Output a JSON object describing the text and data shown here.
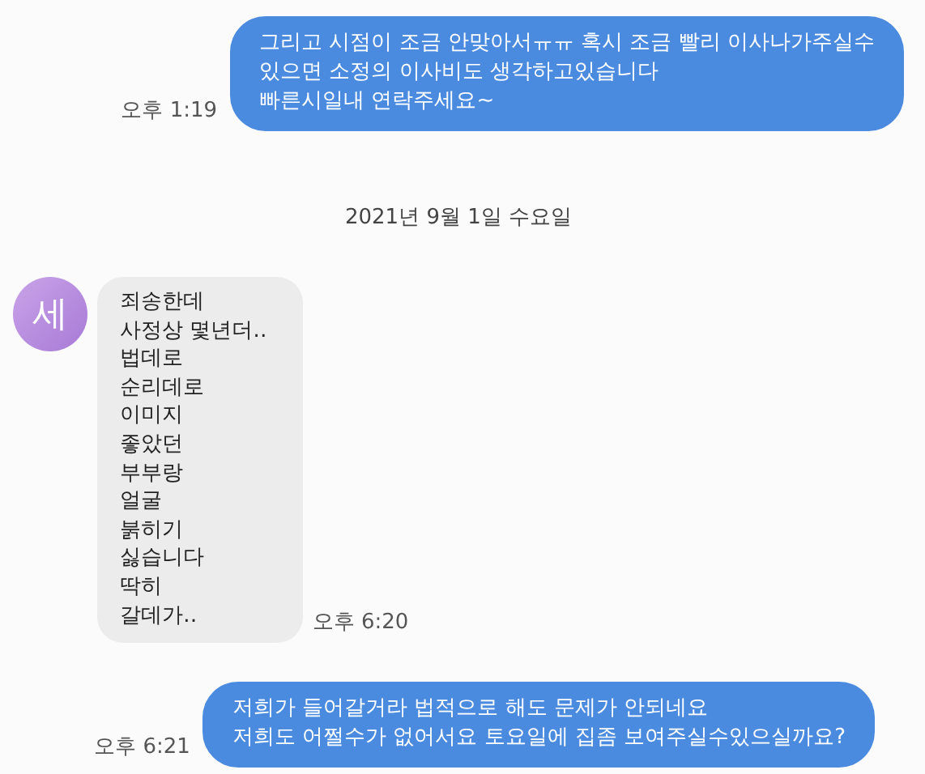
{
  "messages": [
    {
      "kind": "sent",
      "lines": [
        "그리고 시점이 조금 안맞아서ㅠㅠ 혹시 조금 빨리 이사나가주실수",
        "있으면 소정의 이사비도 생각하고있습니다",
        "빠른시일내 연락주세요~"
      ],
      "time": "오후 1:19"
    },
    {
      "kind": "date",
      "text": "2021년 9월 1일 수요일"
    },
    {
      "kind": "received",
      "avatar": "세",
      "lines": [
        "죄송한데",
        "사정상 몇년더‥",
        "법데로",
        "순리데로",
        "이미지",
        "좋았던",
        "부부랑",
        "얼굴",
        "붉히기",
        "싫습니다",
        "딱히",
        "갈데가‥"
      ],
      "time": "오후 6:20"
    },
    {
      "kind": "sent",
      "lines": [
        "저희가 들어갈거라 법적으로 해도 문제가 안되네요",
        "저희도 어쩔수가 없어서요 토요일에 집좀 보여주실수있으실까요?"
      ],
      "time": "오후 6:21"
    }
  ]
}
